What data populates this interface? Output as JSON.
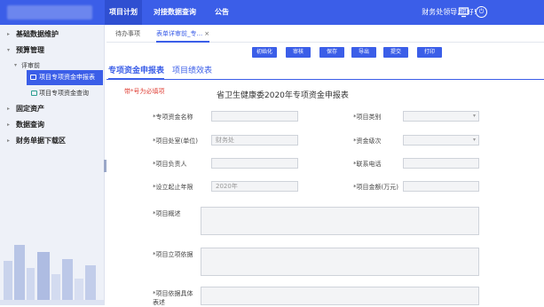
{
  "header": {
    "nav": [
      "项目计划",
      "对接数据查询",
      "公告"
    ],
    "user": "财务处领导,您好!",
    "icons": [
      "monitor-icon",
      "power-icon"
    ]
  },
  "sidebar": {
    "items": [
      {
        "label": "基础数据维护"
      },
      {
        "label": "预算管理"
      },
      {
        "label": "评审前"
      },
      {
        "label": "项目专项资金申报表"
      },
      {
        "label": "项目专项资金查询"
      },
      {
        "label": "固定资产"
      },
      {
        "label": "数据查询"
      },
      {
        "label": "财务单据下载区"
      }
    ]
  },
  "tabs": {
    "todo": "待办事项",
    "form": "表单详审前_专...",
    "close": "×"
  },
  "toolbar": {
    "buttons": [
      "初始化",
      "审核",
      "保存",
      "导出",
      "提交",
      "打印"
    ]
  },
  "subtabs": [
    "专项资金申报表",
    "项目绩效表"
  ],
  "form": {
    "required_note": "带*号为必填项",
    "title": "省卫生健康委2020年专项资金申报表",
    "labels": {
      "fund_name": "*专项资金名称",
      "project_type": "*项目类别",
      "dept": "*项目处室(单位)",
      "fund_level": "*资金级次",
      "leader": "*项目负责人",
      "phone": "*联系电话",
      "years": "*设立起止年限",
      "amount": "*项目金额(万元)",
      "overview": "*项目概述",
      "basis": "*项目立项依据",
      "detail": "*项目依据具体表述"
    },
    "values": {
      "dept": "财务处",
      "years": "2020年"
    }
  }
}
